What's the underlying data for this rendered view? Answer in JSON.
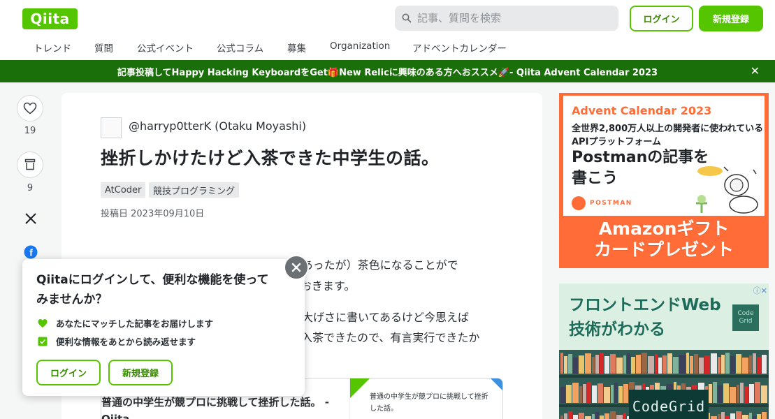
{
  "header": {
    "logo": "Qiita",
    "search_placeholder": "記事、質問を検索",
    "login": "ログイン",
    "signup": "新規登録",
    "nav": [
      "トレンド",
      "質問",
      "公式イベント",
      "公式コラム",
      "募集",
      "Organization",
      "アドベントカレンダー"
    ]
  },
  "banner": {
    "text": "記事投稿してHappy Hacking KeyboardをGet🎁New Relicに興味のある方へおススメ🚀- Qiita Advent Calendar 2023",
    "close": "✕"
  },
  "side": {
    "likes": "19",
    "stocks": "9"
  },
  "article": {
    "author": "@harryp0tterK (Otaku Moyashi)",
    "title": "挫折しかけたけど入茶できた中学生の話。",
    "tags": [
      "AtCoder",
      "競技プログラミング"
    ],
    "posted": "投稿日 2023年09月10日",
    "lines": [
      "中学生の私が、数ヶ月（当然ブランクはあったが）茶色になることがで",
      "きたので、その経験を記事にして残しておきます。",
      "以前、この記事で「競プロで挫折」とか大げさに書いてあるけど今思えば",
      "大したことではなかった。そして無事に入茶できたので、有言実行できたか"
    ],
    "card": {
      "title": "普通の中学生が競プロに挑戦して挫折した話。 - Qiita",
      "thumb_text": "普通の中学生が競プロに挑戦して挫折した話。"
    }
  },
  "popup": {
    "title": "Qiitaにログインして、便利な機能を使ってみませんか？",
    "features": [
      "あなたにマッチした記事をお届けします",
      "便利な情報をあとから読み返せます"
    ],
    "login": "ログイン",
    "signup": "新規登録"
  },
  "ads": {
    "postman": {
      "calendar": "Advent Calendar 2023",
      "desc": "全世界2,800万人以上の開発者に使われているAPIプラットフォーム",
      "headline": "Postmanの記事を書こう",
      "brand": "POSTMAN",
      "promo1": "Amazonギフト",
      "promo2": "カードプレゼント"
    },
    "codegrid": {
      "headline": "フロントエンドWeb技術がわかる",
      "logo": "Code Grid",
      "brand": "CodeGrid"
    }
  },
  "colors": {
    "qiita_green": "#55c500",
    "banner_green": "#1b6f0a",
    "postman_orange": "#ff6c37"
  }
}
